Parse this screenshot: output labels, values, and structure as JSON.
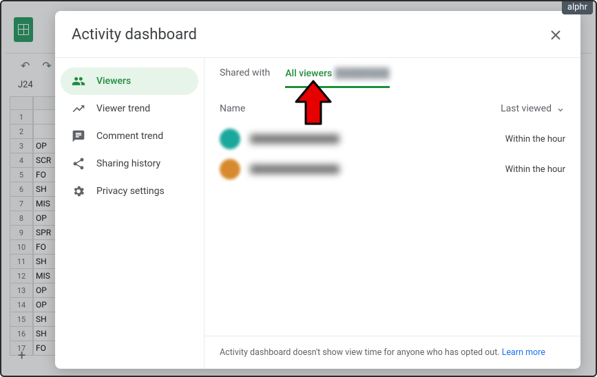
{
  "watermark": "alphr",
  "sheets": {
    "cell_ref": "J24",
    "row_numbers": [
      "1",
      "2",
      "3",
      "4",
      "5",
      "6",
      "7",
      "8",
      "9",
      "10",
      "11",
      "12",
      "13",
      "14",
      "15",
      "16",
      "17"
    ],
    "col_a_values": [
      "",
      "",
      "OP",
      "SCR",
      "FO",
      "SH",
      "MIS",
      "OP",
      "SPR",
      "FO",
      "SH",
      "MIS",
      "OP",
      "OP",
      "SH",
      "SH",
      "FO"
    ]
  },
  "modal": {
    "title": "Activity dashboard",
    "sidebar": {
      "items": [
        {
          "label": "Viewers"
        },
        {
          "label": "Viewer trend"
        },
        {
          "label": "Comment trend"
        },
        {
          "label": "Sharing history"
        },
        {
          "label": "Privacy settings"
        }
      ]
    },
    "tabs": {
      "shared_with": "Shared with",
      "all_viewers": "All viewers"
    },
    "table": {
      "name_header": "Name",
      "last_viewed_header": "Last viewed",
      "rows": [
        {
          "avatar_color": "#1aa89c",
          "last_viewed": "Within the hour"
        },
        {
          "avatar_color": "#d68a2d",
          "last_viewed": "Within the hour"
        }
      ]
    },
    "footer": {
      "text": "Activity dashboard doesn't show view time for anyone who has opted out. ",
      "link": "Learn more"
    }
  }
}
